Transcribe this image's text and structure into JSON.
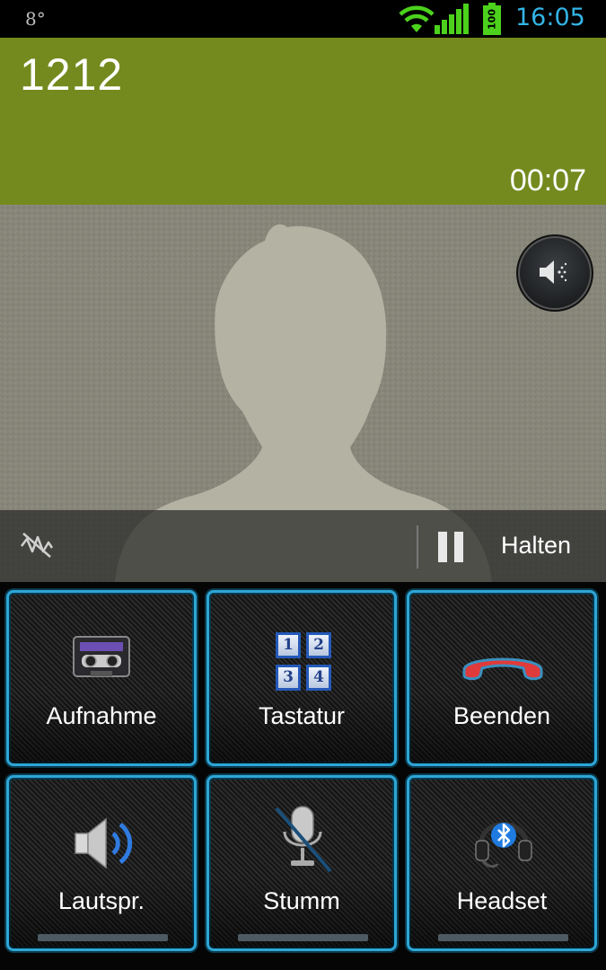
{
  "status_bar": {
    "temperature": "8°",
    "battery": "100",
    "time": "16:05",
    "time_color": "#33b5e5"
  },
  "call": {
    "number": "1212",
    "duration": "00:07",
    "band_color": "#748a1e"
  },
  "actions": {
    "hold_label": "Halten"
  },
  "buttons": [
    {
      "label": "Aufnahme",
      "icon": "cassette-tape-icon"
    },
    {
      "label": "Tastatur",
      "icon": "keypad-icon",
      "keys": [
        "1",
        "2",
        "3",
        "4"
      ]
    },
    {
      "label": "Beenden",
      "icon": "end-call-icon"
    },
    {
      "label": "Lautspr.",
      "icon": "speaker-icon"
    },
    {
      "label": "Stumm",
      "icon": "microphone-muted-icon"
    },
    {
      "label": "Headset",
      "icon": "bluetooth-headset-icon"
    }
  ],
  "colors": {
    "tile_border": "#2ea6d6",
    "end_call_red": "#e03a3a",
    "bluetooth_blue": "#1f7be0"
  }
}
